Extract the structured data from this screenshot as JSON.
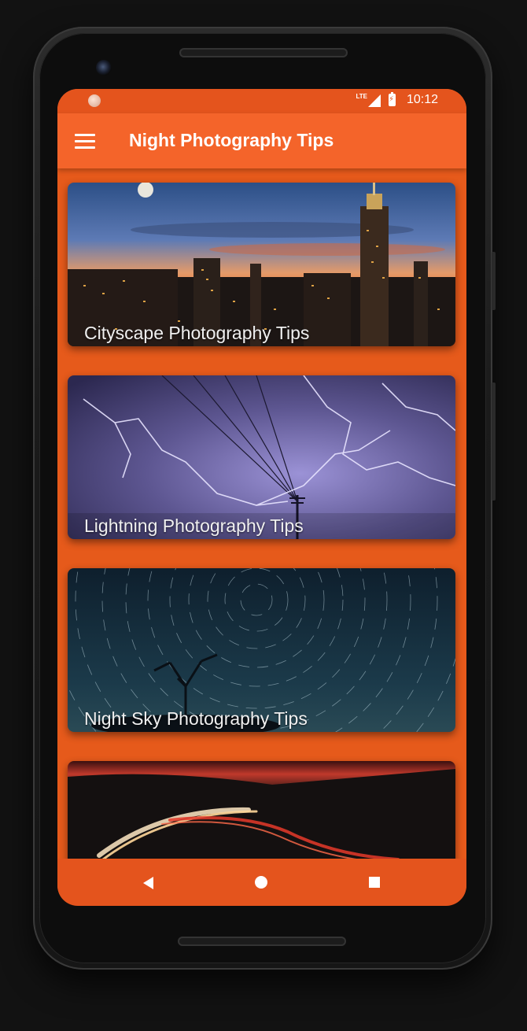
{
  "status_bar": {
    "network": "LTE",
    "time": "10:12"
  },
  "app_bar": {
    "menu_icon": "hamburger-menu-icon",
    "title": "Night Photography Tips"
  },
  "cards": [
    {
      "caption": "Cityscape Photography Tips",
      "image": "city-skyline-sunset"
    },
    {
      "caption": "Lightning Photography Tips",
      "image": "lightning-storm"
    },
    {
      "caption": "Night Sky Photography Tips",
      "image": "star-trails"
    },
    {
      "caption": "",
      "image": "light-trails-road"
    }
  ],
  "nav_bar": {
    "back_icon": "back-triangle-icon",
    "home_icon": "home-circle-icon",
    "recents_icon": "recents-square-icon"
  },
  "colors": {
    "accent": "#f4642a",
    "status_bar": "#e4541d",
    "nav_bar": "#e4541d",
    "screen_bg": "#e65a1b"
  }
}
